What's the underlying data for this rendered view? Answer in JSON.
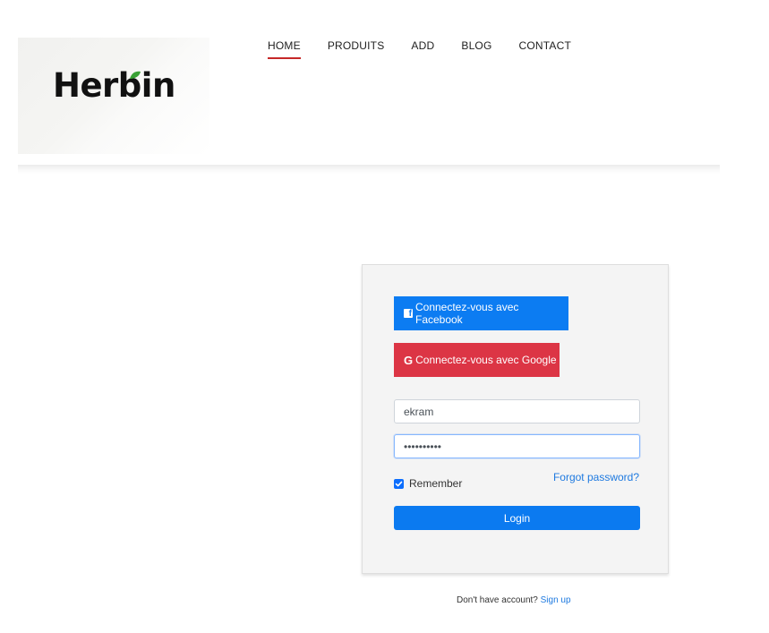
{
  "brand": {
    "name": "Herbin",
    "leaf_color": "#3aa236"
  },
  "nav": {
    "items": [
      {
        "label": "HOME",
        "active": true
      },
      {
        "label": "PRODUITS"
      },
      {
        "label": "ADD"
      },
      {
        "label": "BLOG"
      },
      {
        "label": "CONTACT"
      }
    ],
    "active_color": "#c62828"
  },
  "login": {
    "facebook_label": "Connectez-vous avec Facebook",
    "google_label": "Connectez-vous avec Google",
    "username_value": "ekram",
    "password_value": "••••••••••",
    "remember_label": "Remember",
    "remember_checked": true,
    "forgot_label": "Forgot password?",
    "login_label": "Login",
    "colors": {
      "facebook": "#0c7cf2",
      "google": "#dc3545",
      "primary": "#0b7af0",
      "link": "#1f7ae0"
    }
  },
  "signup": {
    "prompt": "Don't have account?",
    "link_label": "Sign up"
  }
}
